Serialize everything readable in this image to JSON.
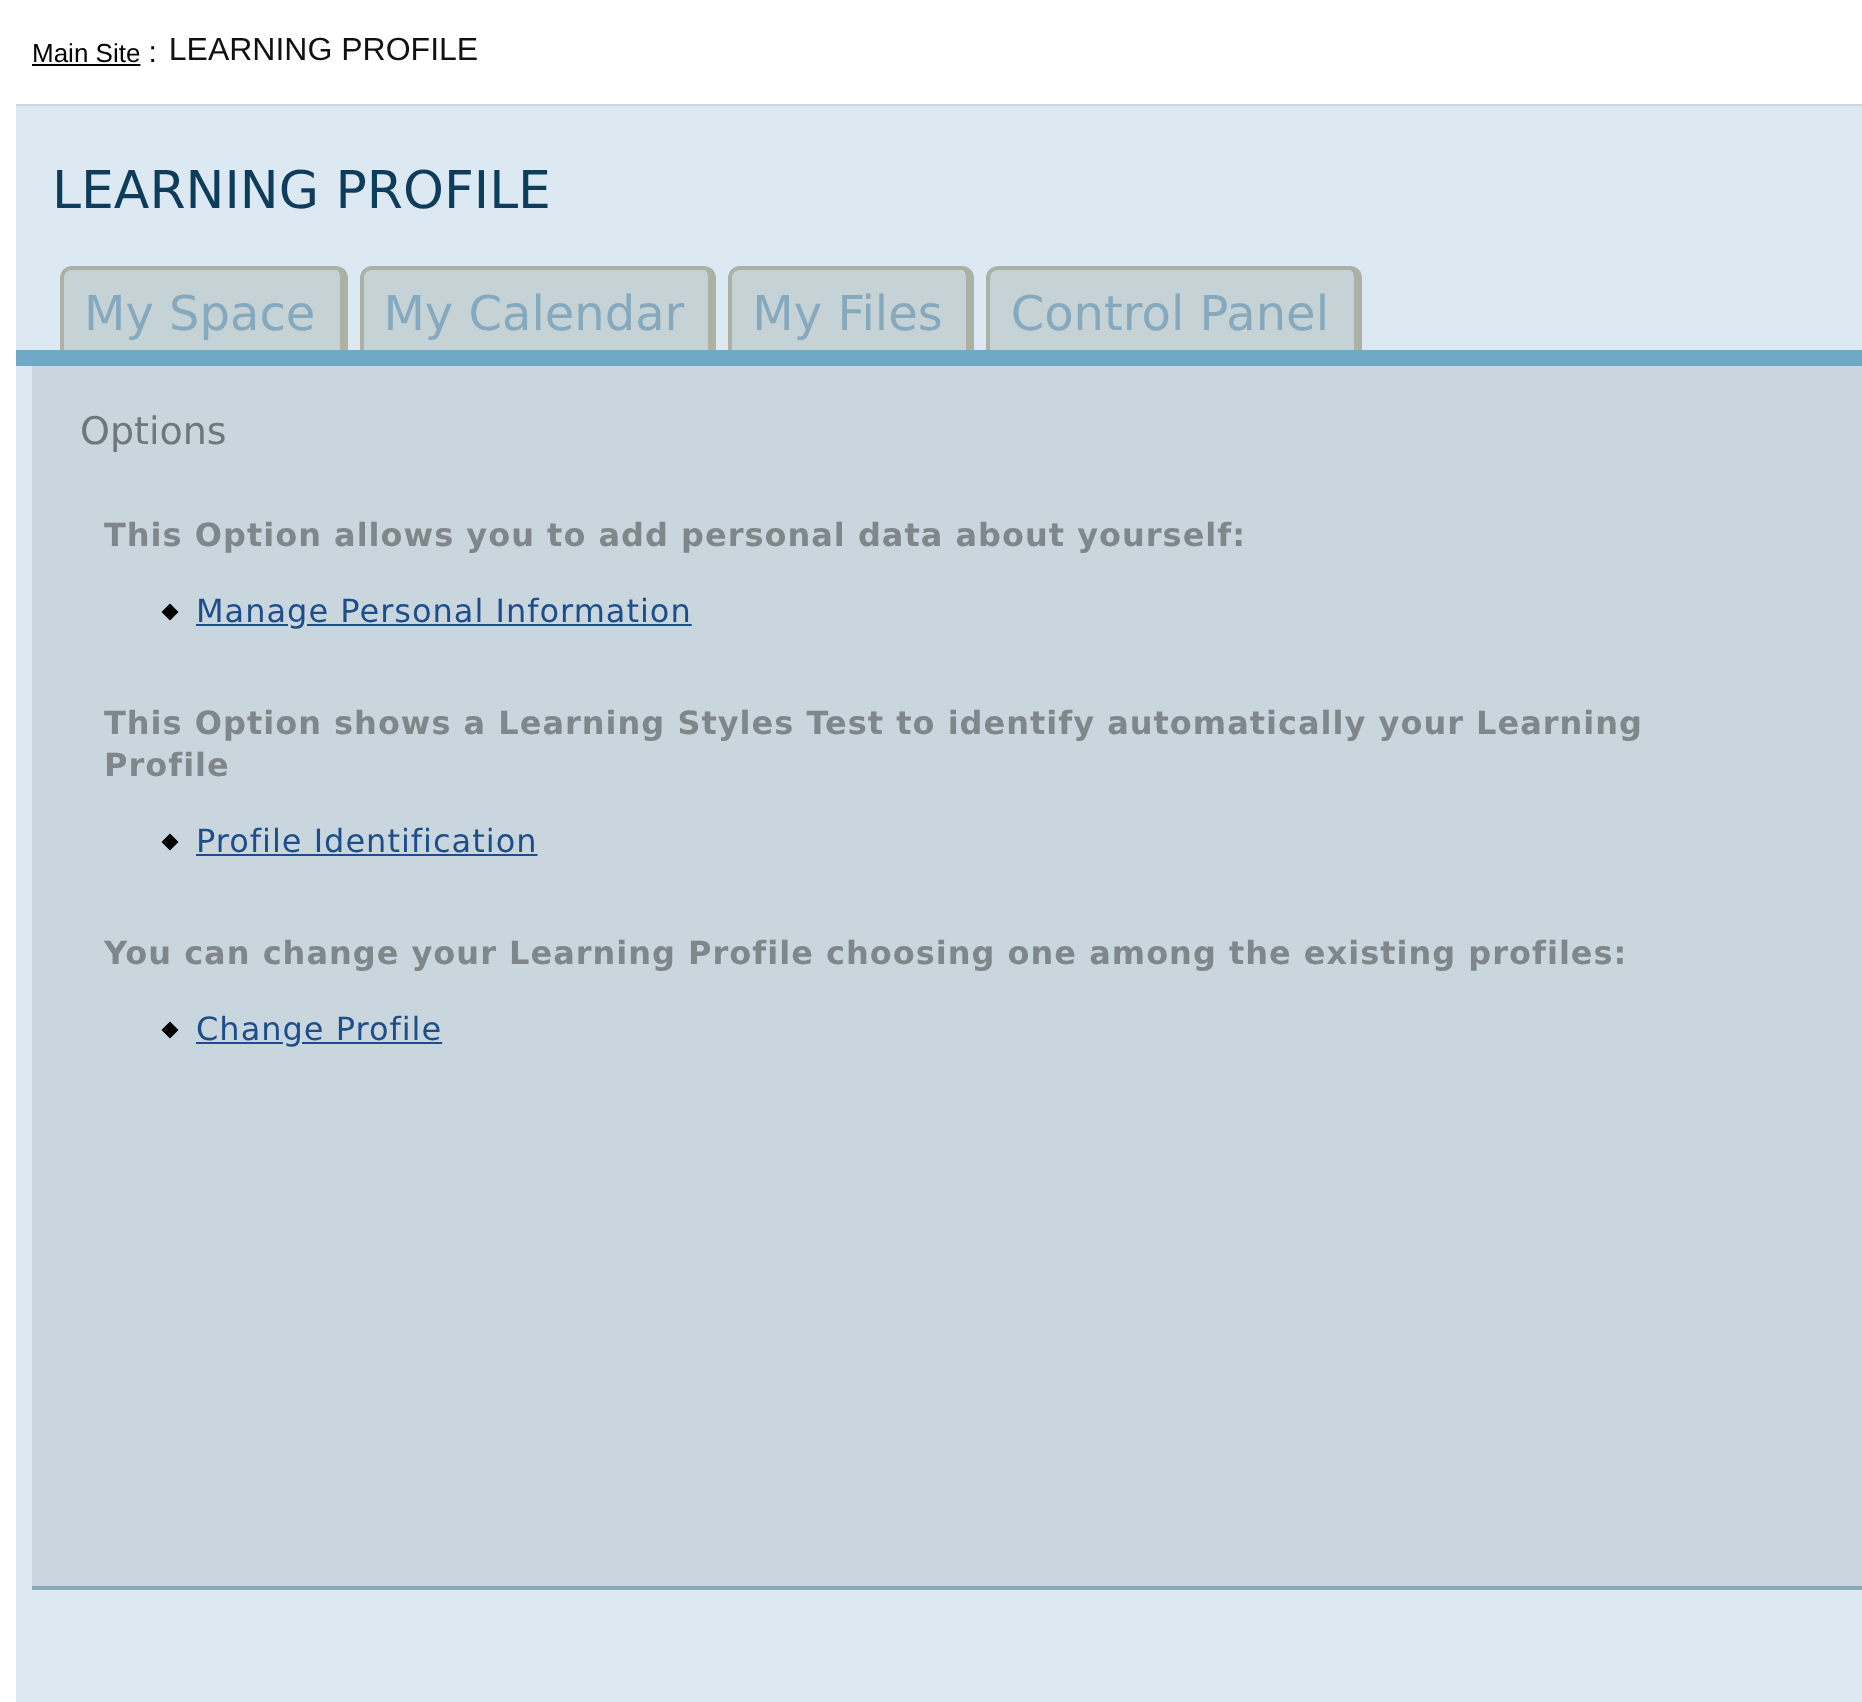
{
  "breadcrumb": {
    "link": "Main Site",
    "separator": ":",
    "current": "LEARNING PROFILE"
  },
  "title": "LEARNING PROFILE",
  "tabs": [
    {
      "label": "My Space",
      "selected": false
    },
    {
      "label": "My Calendar",
      "selected": false
    },
    {
      "label": "My Files",
      "selected": false
    },
    {
      "label": "Control Panel",
      "selected": false
    }
  ],
  "panel": {
    "heading": "Options",
    "sections": [
      {
        "text": "This Option allows you to add personal data about yourself:",
        "link": "Manage Personal Information"
      },
      {
        "text": "This Option shows a Learning Styles Test to identify automatically your Learning Profile",
        "link": "Profile Identification"
      },
      {
        "text": "You can change your Learning Profile choosing one among the existing profiles:",
        "link": "Change Profile"
      }
    ]
  }
}
